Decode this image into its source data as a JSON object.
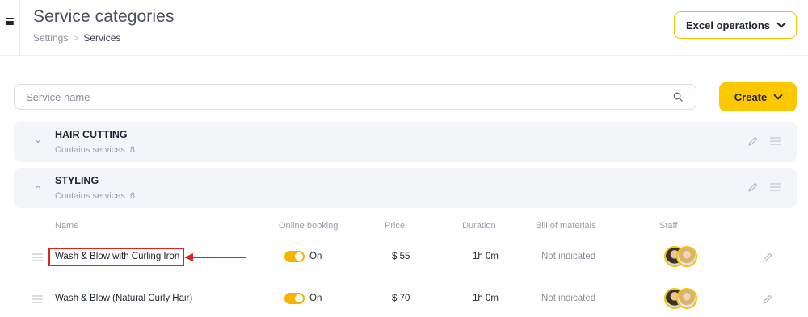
{
  "header": {
    "title": "Service categories",
    "breadcrumb": [
      "Settings",
      ">",
      "Services"
    ],
    "excel_button": "Excel operations"
  },
  "search": {
    "placeholder": "Service name",
    "value": ""
  },
  "create_button": "Create",
  "categories": [
    {
      "name": "HAIR CUTTING",
      "count_text": "Contains services: 8",
      "expanded": false
    },
    {
      "name": "STYLING",
      "count_text": "Contains services: 6",
      "expanded": true
    }
  ],
  "columns": {
    "name": "Name",
    "online_booking": "Online booking",
    "price": "Price",
    "duration": "Duration",
    "bill_of_materials": "Bill of materials",
    "staff": "Staff"
  },
  "services": [
    {
      "name": "Wash & Blow with Curling Iron",
      "online_booking": "On",
      "price": "$ 55",
      "duration": "1h 0m",
      "bill_of_materials": "Not indicated",
      "highlighted": true
    },
    {
      "name": "Wash & Blow (Natural Curly Hair)",
      "online_booking": "On",
      "price": "$ 70",
      "duration": "1h 0m",
      "bill_of_materials": "Not indicated",
      "highlighted": false
    }
  ],
  "colors": {
    "accent": "#fbc800",
    "annotation": "#e3221b",
    "category_bg": "#f4f5f8"
  },
  "icons": [
    "menu-icon",
    "chevron-down-icon",
    "search-icon",
    "chevron-up-icon",
    "pencil-icon",
    "drag-handle-icon",
    "arrow-left-icon"
  ]
}
